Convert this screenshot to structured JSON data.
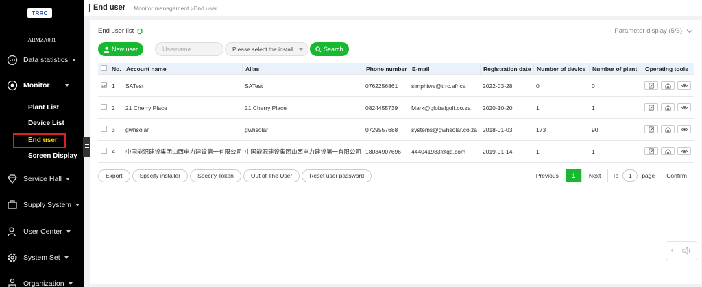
{
  "sidebar": {
    "logo_text": "TRRC",
    "company": "ARMZA001",
    "items": [
      {
        "label": "Data statistics",
        "icon": "chart-icon"
      },
      {
        "label": "Monitor",
        "icon": "monitor-icon"
      },
      {
        "label": "Service Hall",
        "icon": "diamond-icon"
      },
      {
        "label": "Supply System",
        "icon": "supply-icon"
      },
      {
        "label": "User Center",
        "icon": "user-icon"
      },
      {
        "label": "System Set",
        "icon": "gear-icon"
      },
      {
        "label": "Organization",
        "icon": "org-icon"
      }
    ],
    "monitor_sub": [
      "Plant List",
      "Device List",
      "End user",
      "Screen Display"
    ]
  },
  "header": {
    "title": "End user",
    "breadcrumb": "Monitor management >End user"
  },
  "main": {
    "list_title": "End user list",
    "param_display": "Parameter display",
    "param_count": "(5/6)",
    "new_user": "New user",
    "username_placeholder": "Username",
    "install_select": "Please select the install",
    "search": "Search",
    "columns": [
      "No.",
      "Account name",
      "Alias",
      "Phone number",
      "E-mail",
      "Registration date",
      "Number of device",
      "Number of plant",
      "Operating tools"
    ],
    "rows": [
      {
        "no": "1",
        "account": "SATest",
        "alias": "SATest",
        "phone": "0762256861",
        "email": "simphiwe@trrc.africa",
        "date": "2022-03-28",
        "devices": "0",
        "plants": "0",
        "checked": true
      },
      {
        "no": "2",
        "account": "21 Cherry Place",
        "alias": "21 Cherry Place",
        "phone": "0824455739",
        "email": "Mark@globalgolf.co.za",
        "date": "2020-10-20",
        "devices": "1",
        "plants": "1",
        "checked": false
      },
      {
        "no": "3",
        "account": "gwhsolar",
        "alias": "gwhsolar",
        "phone": "0729557688",
        "email": "systems@gwhsolar.co.za",
        "date": "2018-01-03",
        "devices": "173",
        "plants": "90",
        "checked": false
      },
      {
        "no": "4",
        "account": "中国能源建设集团山西电力建设第一有限公司",
        "alias": "中国能源建设集团山西电力建设第一有限公司",
        "phone": "18034907696",
        "email": "444041983@qq.com",
        "date": "2019-01-14",
        "devices": "1",
        "plants": "1",
        "checked": false
      }
    ],
    "actions": [
      "Export",
      "Specify installer",
      "Specify Token",
      "Out of The User",
      "Reset user password"
    ],
    "pager": {
      "previous": "Previous",
      "current": "1",
      "next": "Next",
      "to": "To",
      "page_input": "1",
      "page": "page",
      "confirm": "Confirm"
    }
  },
  "colors": {
    "accent": "#18b830",
    "sidebar": "#000000",
    "header_row": "#e9f2fb",
    "highlight": "#e02020"
  }
}
